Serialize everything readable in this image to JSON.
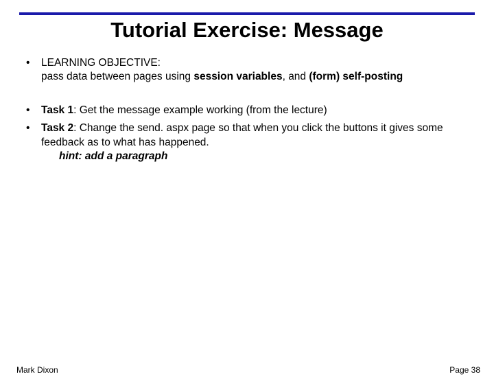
{
  "title": "Tutorial Exercise: Message",
  "objective": {
    "label": "LEARNING OBJECTIVE:",
    "text_prefix": "pass data between pages using ",
    "bold1": "session variables",
    "mid": ", and ",
    "bold2": "(form) self-posting"
  },
  "tasks": [
    {
      "label": "Task 1",
      "text": ": Get the message example working (from the lecture)"
    },
    {
      "label": "Task 2",
      "text": ": Change the send. aspx page so that when you click the buttons it gives some feedback as to what has happened."
    }
  ],
  "hint": "hint: add a paragraph",
  "footer": {
    "author": "Mark Dixon",
    "page": "Page 38"
  },
  "bullet_char": "•"
}
